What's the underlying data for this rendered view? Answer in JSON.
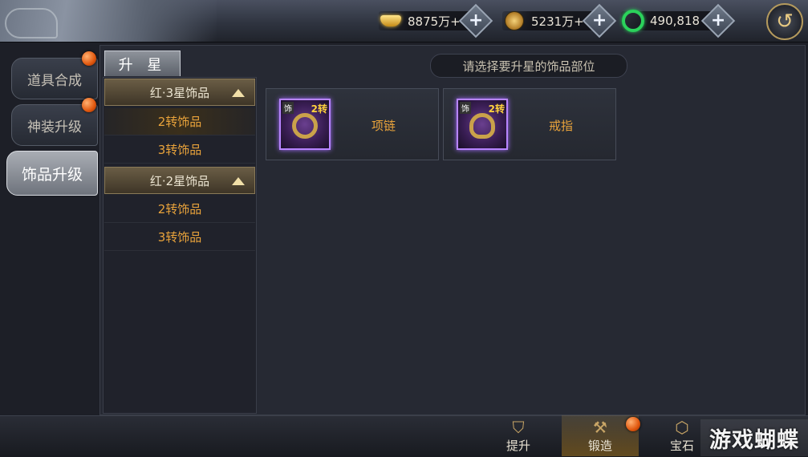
{
  "currencies": [
    {
      "name": "gold-ingot",
      "value": "8875万+"
    },
    {
      "name": "coin",
      "value": "5231万+"
    },
    {
      "name": "jade",
      "value": "490,818"
    }
  ],
  "side_tabs": [
    {
      "label": "道具合成",
      "badge": true
    },
    {
      "label": "神装升级",
      "badge": true
    },
    {
      "label": "饰品升级",
      "badge": false,
      "active": true
    }
  ],
  "sub_tab": "升 星",
  "groups": [
    {
      "title": "红·3星饰品",
      "items": [
        "2转饰品",
        "3转饰品"
      ]
    },
    {
      "title": "红·2星饰品",
      "items": [
        "2转饰品",
        "3转饰品"
      ]
    }
  ],
  "hint": "请选择要升星的饰品部位",
  "slots": [
    {
      "name": "项链",
      "level": "2转",
      "tag": "饰"
    },
    {
      "name": "戒指",
      "level": "2转",
      "tag": "饰"
    }
  ],
  "bottom_nav": [
    {
      "label": "提升",
      "icon": "helmet-icon"
    },
    {
      "label": "锻造",
      "icon": "anvil-icon",
      "active": true,
      "badge": true
    },
    {
      "label": "宝石",
      "icon": "gem-icon"
    }
  ],
  "watermark": "游戏蝴蝶"
}
